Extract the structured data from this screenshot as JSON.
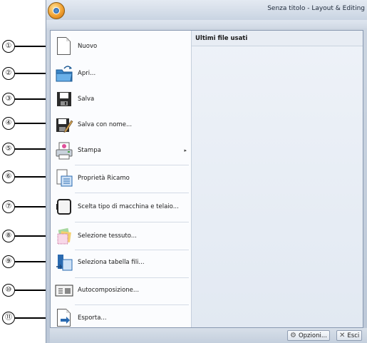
{
  "window": {
    "title": "Senza titolo - Layout & Editing"
  },
  "menu": {
    "recent_header": "Ultimi file usati",
    "items": [
      {
        "label": "Nuovo",
        "icon": "new-document-icon",
        "callout": "①"
      },
      {
        "label": "Apri...",
        "icon": "open-folder-icon",
        "callout": "②"
      },
      {
        "label": "Salva",
        "icon": "save-disk-icon",
        "callout": "③"
      },
      {
        "label": "Salva con nome...",
        "icon": "save-as-icon",
        "callout": "④"
      },
      {
        "label": "Stampa",
        "icon": "print-icon",
        "callout": "⑤",
        "submenu": "▸"
      },
      {
        "label": "Proprietà Ricamo",
        "icon": "properties-icon",
        "callout": "⑥"
      },
      {
        "label": "Scelta tipo di macchina e telaio...",
        "icon": "hoop-icon",
        "callout": "⑦"
      },
      {
        "label": "Selezione tessuto...",
        "icon": "fabric-icon",
        "callout": "⑧"
      },
      {
        "label": "Seleziona tabella fili...",
        "icon": "thread-chart-icon",
        "callout": "⑨"
      },
      {
        "label": "Autocomposizione...",
        "icon": "wizard-icon",
        "callout": "⑩"
      },
      {
        "label": "Esporta...",
        "icon": "export-icon",
        "callout": "⑪"
      }
    ]
  },
  "footer": {
    "options_label": "Opzioni...",
    "exit_label": "Esci"
  }
}
